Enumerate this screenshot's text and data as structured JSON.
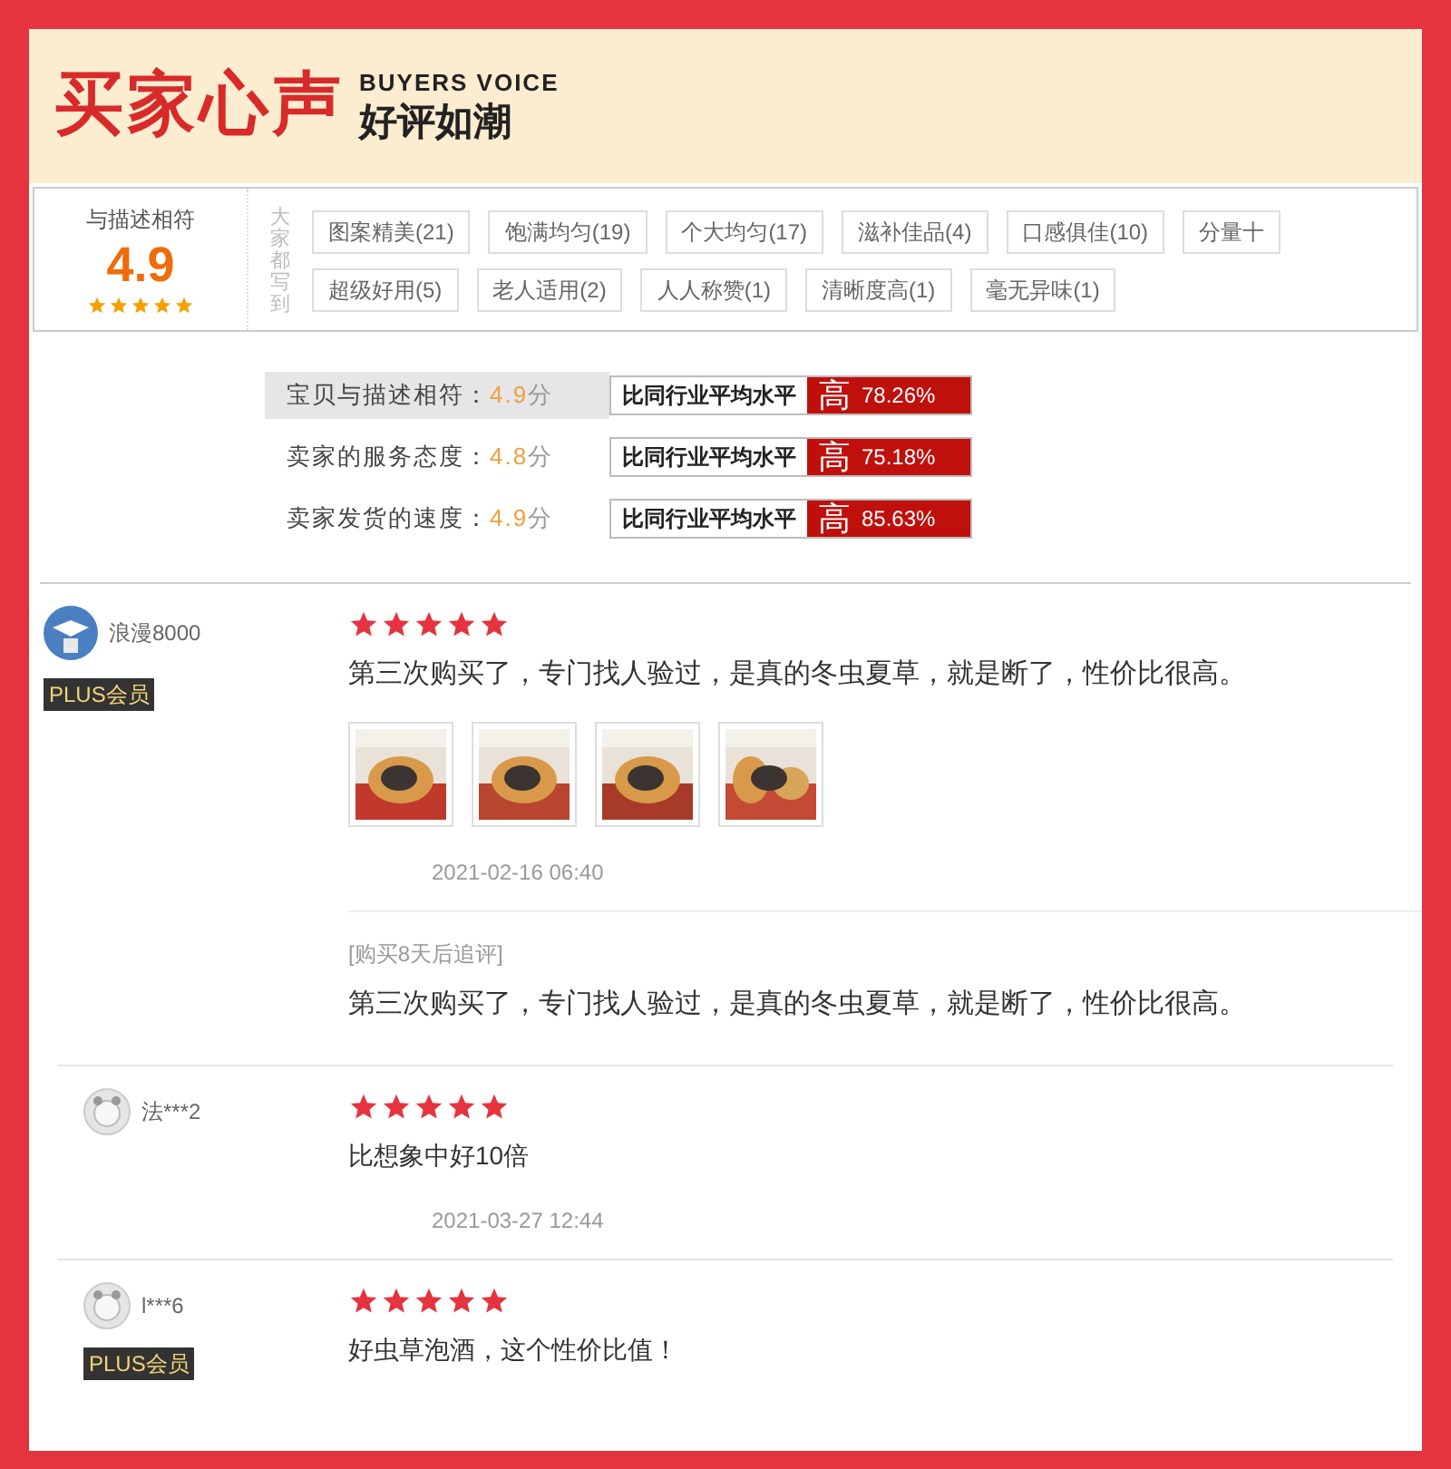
{
  "header": {
    "title": "买家心声",
    "subtitle_en": "BUYERS VOICE",
    "subtitle": "好评如潮"
  },
  "summary": {
    "label": "与描述相符",
    "score": "4.9",
    "stars": 5,
    "tags_heading": "大家都写到",
    "tags": [
      {
        "label": "图案精美(21)"
      },
      {
        "label": "饱满均匀(19)"
      },
      {
        "label": "个大均匀(17)"
      },
      {
        "label": "滋补佳品(4)"
      },
      {
        "label": "口感俱佳(10)"
      },
      {
        "label": "分量十"
      },
      {
        "label": "超级好用(5)"
      },
      {
        "label": "老人适用(2)"
      },
      {
        "label": "人人称赞(1)"
      },
      {
        "label": "清晰度高(1)"
      },
      {
        "label": "毫无异味(1)"
      }
    ]
  },
  "ratings": [
    {
      "label": "宝贝与描述相符：",
      "score": "4.9",
      "unit": "分",
      "compare": "比同行业平均水平",
      "level_word": "高",
      "percent": "78.26%",
      "selected": true
    },
    {
      "label": "卖家的服务态度：",
      "score": "4.8",
      "unit": "分",
      "compare": "比同行业平均水平",
      "level_word": "高",
      "percent": "75.18%",
      "selected": false
    },
    {
      "label": "卖家发货的速度：",
      "score": "4.9",
      "unit": "分",
      "compare": "比同行业平均水平",
      "level_word": "高",
      "percent": "85.63%",
      "selected": false
    }
  ],
  "reviews": [
    {
      "kind": "cartoon",
      "user": "浪漫8000",
      "badge": "PLUS会员",
      "stars": 5,
      "text": "第三次购买了，专门找人验过，是真的冬虫夏草，就是断了，性价比很高。",
      "photos": [
        {
          "kind": "picture"
        },
        {
          "kind": "picture"
        },
        {
          "kind": "picture"
        },
        {
          "kind": "picture"
        }
      ],
      "date": "2021-02-16 06:40",
      "followup": {
        "label": "[购买8天后追评]",
        "text": "第三次购买了，专门找人验过，是真的冬虫夏草，就是断了，性价比很高。"
      }
    },
    {
      "kind": "default",
      "user": "法***2",
      "stars": 5,
      "text": "比想象中好10倍",
      "date": "2021-03-27 12:44"
    },
    {
      "kind": "default",
      "user": "l***6",
      "badge": "PLUS会员",
      "stars": 5,
      "text": "好虫草泡酒，这个性价比值！"
    }
  ]
}
